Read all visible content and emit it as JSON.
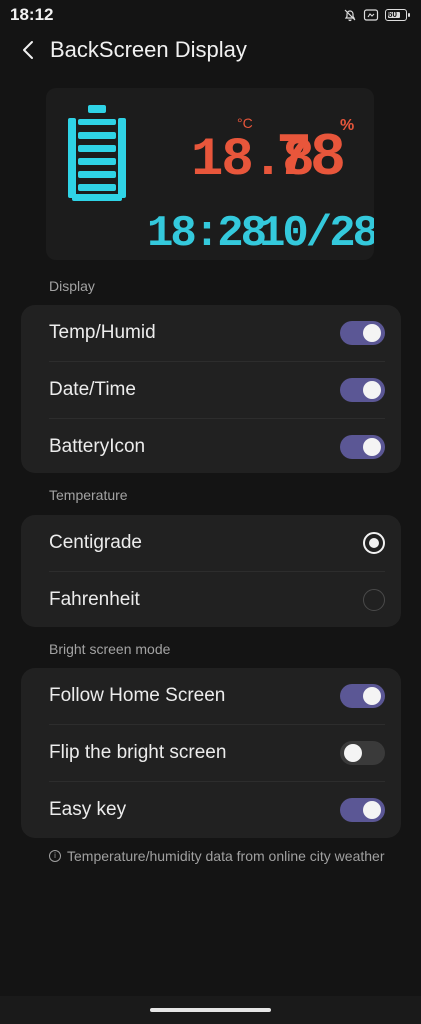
{
  "status_bar": {
    "time": "18:12",
    "battery_level": "60"
  },
  "header": {
    "title": "BackScreen Display"
  },
  "preview": {
    "temperature": "18.8",
    "temp_unit_symbol": "°C",
    "humidity": "78",
    "humidity_unit": "%",
    "time": "18:28",
    "date": "10/28",
    "colors": {
      "temp": "#e8563b",
      "clock": "#34c9dc",
      "battery": "#2fd3e6"
    }
  },
  "sections": {
    "display": {
      "label": "Display",
      "items": [
        {
          "label": "Temp/Humid",
          "on": true
        },
        {
          "label": "Date/Time",
          "on": true
        },
        {
          "label": "BatteryIcon",
          "on": true
        }
      ]
    },
    "temperature": {
      "label": "Temperature",
      "options": [
        {
          "label": "Centigrade",
          "selected": true
        },
        {
          "label": "Fahrenheit",
          "selected": false
        }
      ]
    },
    "bright": {
      "label": "Bright screen mode",
      "items": [
        {
          "label": "Follow Home Screen",
          "on": true
        },
        {
          "label": "Flip the bright screen",
          "on": false
        },
        {
          "label": "Easy key",
          "on": true
        }
      ]
    }
  },
  "footnote": "Temperature/humidity data from online city weather",
  "accent_color": "#5b5795"
}
